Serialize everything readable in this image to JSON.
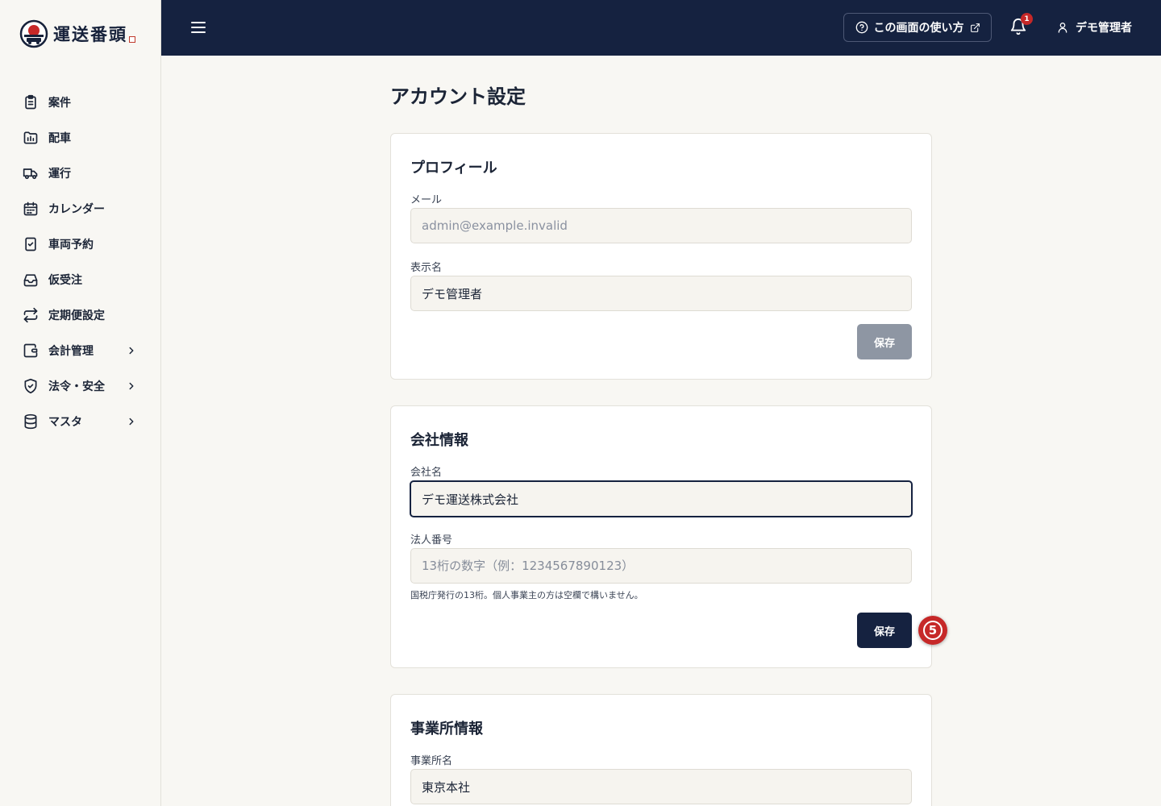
{
  "app": {
    "logo_text": "運送番頭"
  },
  "sidebar": {
    "items": [
      {
        "label": "案件"
      },
      {
        "label": "配車"
      },
      {
        "label": "運行"
      },
      {
        "label": "カレンダー"
      },
      {
        "label": "車両予約"
      },
      {
        "label": "仮受注"
      },
      {
        "label": "定期便設定"
      },
      {
        "label": "会計管理"
      },
      {
        "label": "法令・安全"
      },
      {
        "label": "マスタ"
      }
    ]
  },
  "header": {
    "help_label": "この画面の使い方",
    "notification_count": "1",
    "user_name": "デモ管理者"
  },
  "page": {
    "title": "アカウント設定"
  },
  "profile": {
    "title": "プロフィール",
    "email_label": "メール",
    "email_value": "admin@example.invalid",
    "display_name_label": "表示名",
    "display_name_value": "デモ管理者",
    "save_label": "保存"
  },
  "company": {
    "title": "会社情報",
    "name_label": "会社名",
    "name_value": "デモ運送株式会社",
    "corp_number_label": "法人番号",
    "corp_number_placeholder": "13桁の数字（例：1234567890123）",
    "corp_number_hint": "国税庁発行の13桁。個人事業主の方は空欄で構いません。",
    "save_label": "保存",
    "step_marker": "5"
  },
  "office": {
    "title": "事業所情報",
    "name_label": "事業所名",
    "name_value": "東京本社"
  },
  "colors": {
    "navy": "#152240",
    "accent_red": "#c62828",
    "background": "#f8f7f3"
  }
}
